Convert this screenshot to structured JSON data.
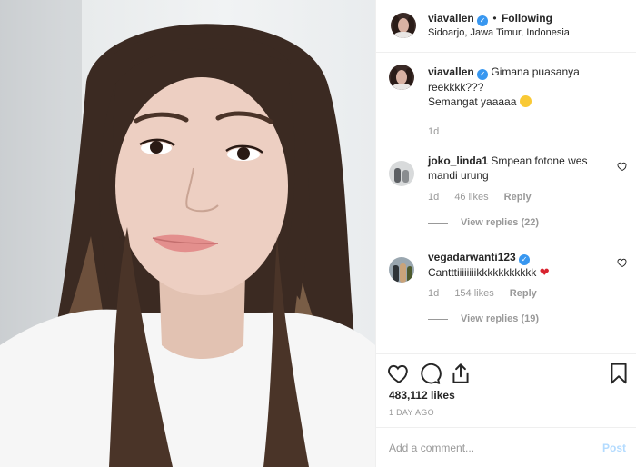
{
  "header": {
    "username": "viavallen",
    "separator": "•",
    "follow_status": "Following",
    "location": "Sidoarjo, Jawa Timur, Indonesia",
    "verified_mark": "✓"
  },
  "caption": {
    "username": "viavallen",
    "text_line1": "Gimana puasanya",
    "text_line2": "reekkkk???",
    "text_line3": "Semangat yaaaaa",
    "emoji": "smiling-face-icon",
    "time": "1d"
  },
  "comments": [
    {
      "username": "joko_linda1",
      "text_line1": "Smpean fotone wes",
      "text_line2": "mandi urung",
      "time": "1d",
      "likes": "46 likes",
      "reply_label": "Reply",
      "view_replies": "View replies (22)"
    },
    {
      "username": "vegadarwanti123",
      "text_line1": "Cantttiiiiiiiikkkkkkkkkkk",
      "heart": "❤",
      "time": "1d",
      "likes": "154 likes",
      "reply_label": "Reply",
      "view_replies": "View replies (19)"
    }
  ],
  "actions": {
    "like_icon": "heart-icon",
    "comment_icon": "comment-icon",
    "share_icon": "share-icon",
    "save_icon": "bookmark-icon",
    "likes_count": "483,112 likes",
    "posted_ago": "1 DAY AGO"
  },
  "add_comment": {
    "placeholder": "Add a comment...",
    "post_label": "Post"
  },
  "colors": {
    "verified": "#3897f0",
    "muted": "#999999",
    "post_disabled": "#b3dbff",
    "border": "#efefef"
  }
}
